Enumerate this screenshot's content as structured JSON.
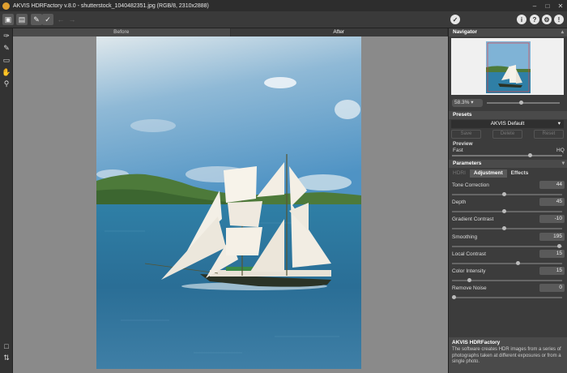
{
  "window": {
    "title": "AKVIS HDRFactory v.8.0 - shutterstock_1040482351.jpg (RGB/8, 2310x2888)"
  },
  "toolbar": {
    "apply_icon": "check-icon",
    "info_icon": "info-icon",
    "help_icon": "help-icon",
    "settings_icon": "gear-icon",
    "notify_icon": "notification-icon"
  },
  "tabs": {
    "before": "Before",
    "after": "After"
  },
  "navigator": {
    "title": "Navigator",
    "zoom": "58.3%",
    "zoom_fraction": 0.45
  },
  "presets": {
    "title": "Presets",
    "selected": "AKVIS Default",
    "save": "Save",
    "delete": "Delete",
    "reset": "Reset"
  },
  "preview": {
    "title": "Preview",
    "fast": "Fast",
    "hq": "HQ",
    "level": 0.72
  },
  "parameters": {
    "title": "Parameters",
    "tabs": [
      "HDRI",
      "Adjustment",
      "Effects"
    ],
    "items": [
      {
        "name": "Tone Correction",
        "value": "44",
        "level": 0.47
      },
      {
        "name": "Depth",
        "value": "45",
        "level": 0.47
      },
      {
        "name": "Gradient Contrast",
        "value": "-10",
        "level": 0.47
      },
      {
        "name": "Smoothing",
        "value": "195",
        "level": 0.98
      },
      {
        "name": "Local Contrast",
        "value": "15",
        "level": 0.6
      },
      {
        "name": "Color Intensity",
        "value": "15",
        "level": 0.15
      },
      {
        "name": "Remove Noise",
        "value": "0",
        "level": 0.0
      }
    ]
  },
  "info": {
    "title": "AKVIS HDRFactory",
    "text": "The software creates HDR images from a series of photographs taken at different exposures or from a single photo."
  }
}
